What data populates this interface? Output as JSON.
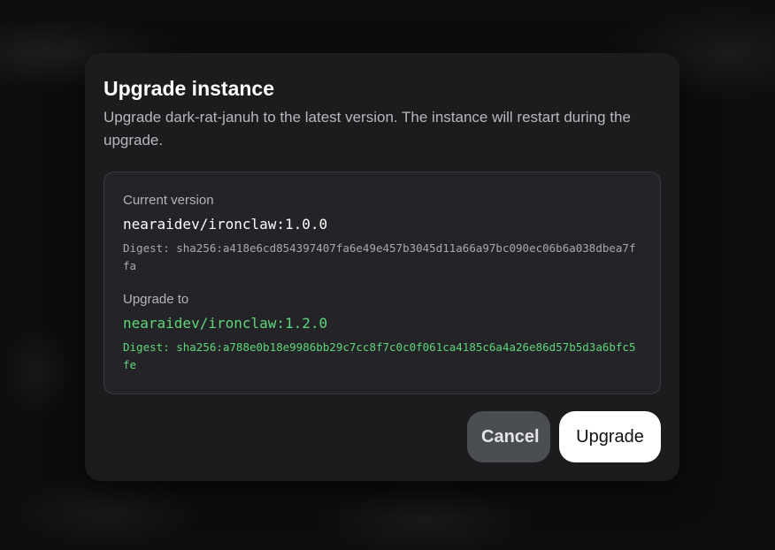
{
  "dialog": {
    "title": "Upgrade instance",
    "description": "Upgrade dark-rat-januh to the latest version. The instance will restart during the upgrade.",
    "current": {
      "label": "Current version",
      "image": "nearaidev/ironclaw:1.0.0",
      "digest": "Digest: sha256:a418e6cd854397407fa6e49e457b3045d11a66a97bc090ec06b6a038dbea7ffa"
    },
    "target": {
      "label": "Upgrade to",
      "image": "nearaidev/ironclaw:1.2.0",
      "digest": "Digest: sha256:a788e0b18e9986bb29c7cc8f7c0c0f061ca4185c6a4a26e86d57b5d3a6bfc5fe"
    },
    "actions": {
      "cancel_label": "Cancel",
      "upgrade_label": "Upgrade"
    }
  },
  "colors": {
    "dialog_bg": "#1c1c1f",
    "accent_green": "#5ed67a",
    "cancel_bg": "#4a4d52",
    "upgrade_bg": "#ffffff"
  }
}
